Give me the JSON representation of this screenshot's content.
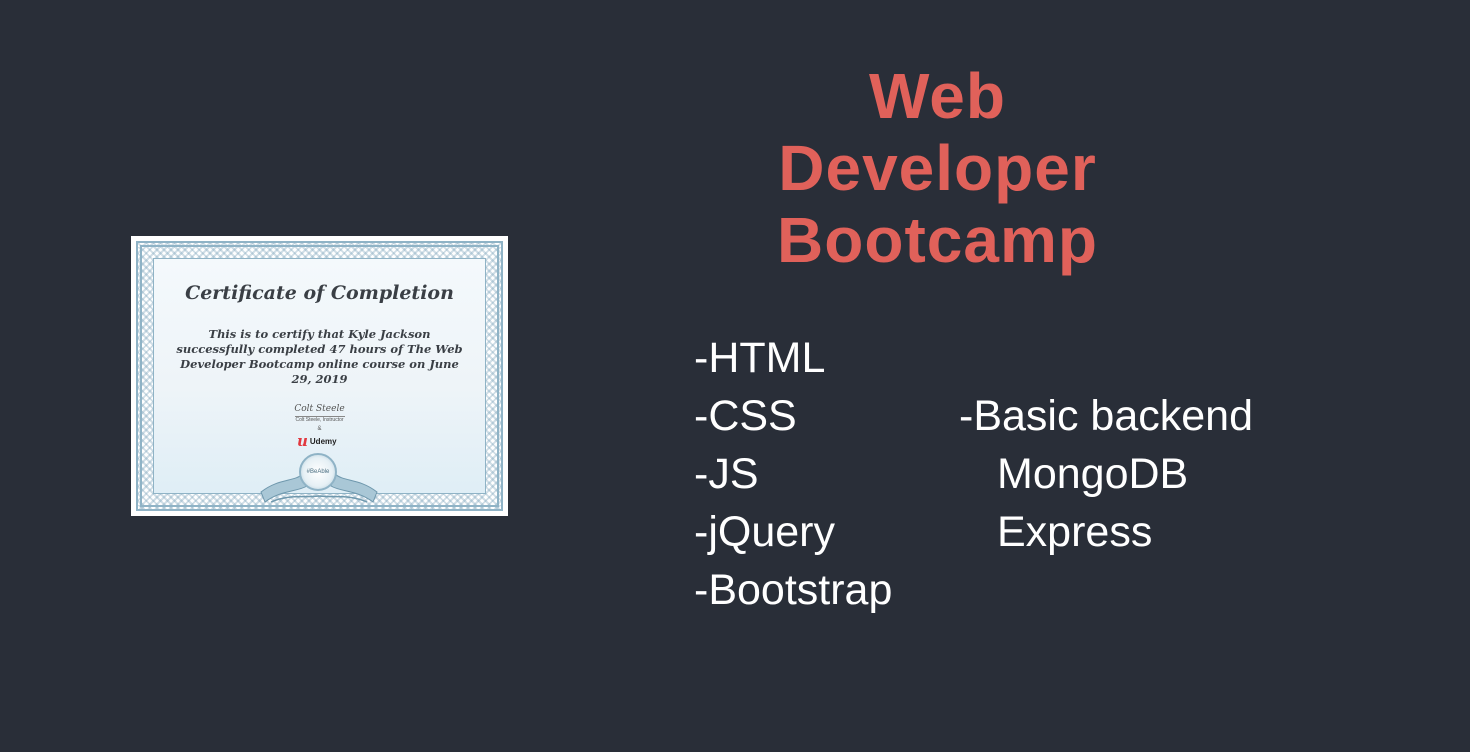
{
  "title": {
    "line1": "Web",
    "line2": "Developer",
    "line3": "Bootcamp"
  },
  "certificate": {
    "heading": "Certificate of Completion",
    "body": "This is to certify that Kyle Jackson successfully completed 47 hours of The Web Developer Bootcamp online course on June 29, 2019",
    "signature": "Colt Steele",
    "signer": "Colt Steele, Instructor",
    "ampersand": "&",
    "logo_mark": "u",
    "logo_text": "Udemy",
    "seal_text": "#BeAble"
  },
  "skills_left": [
    "-HTML",
    "-CSS",
    "-JS",
    "-jQuery",
    "-Bootstrap"
  ],
  "skills_right": [
    "-Basic backend",
    "MongoDB",
    "Express"
  ],
  "colors": {
    "background": "#292e38",
    "title": "#e0615a",
    "text": "#ffffff"
  }
}
